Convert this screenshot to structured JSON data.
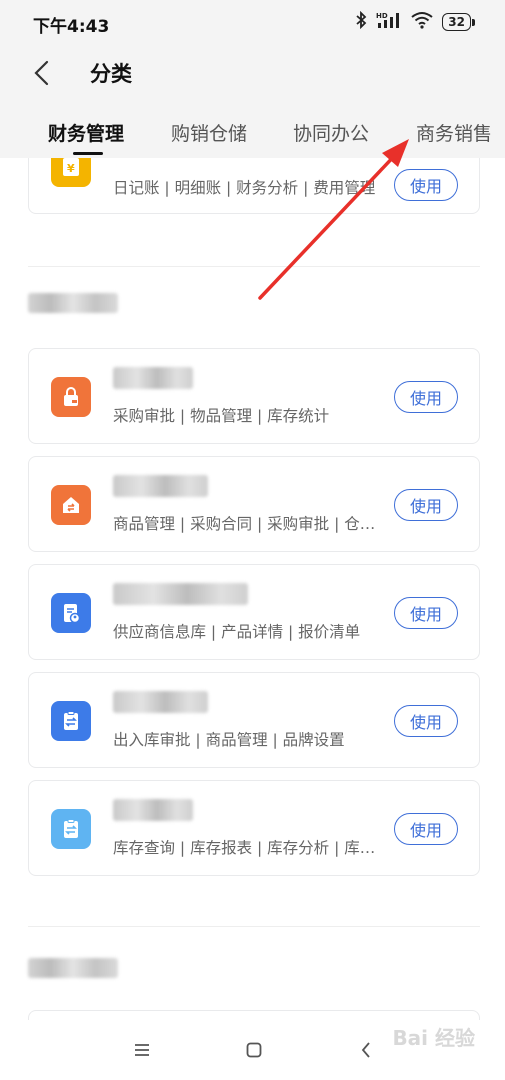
{
  "status_bar": {
    "time": "下午4:43",
    "battery": "32"
  },
  "header": {
    "title": "分类"
  },
  "tabs": [
    "财务管理",
    "购销仓储",
    "协同办公",
    "商务销售"
  ],
  "cards": [
    {
      "desc": "日记账 | 明细账 | 财务分析 | 费用管理",
      "button": "使用",
      "icon": "finance-icon",
      "color": "#f4b400"
    },
    {
      "desc": "采购审批 | 物品管理 | 库存统计",
      "button": "使用",
      "icon": "purchase-icon",
      "color": "#f0743a"
    },
    {
      "desc": "商品管理 | 采购合同 | 采购审批 | 仓库管理",
      "button": "使用",
      "icon": "warehouse-icon",
      "color": "#f0743a"
    },
    {
      "desc": "供应商信息库 | 产品详情 | 报价清单",
      "button": "使用",
      "icon": "supplier-icon",
      "color": "#3d7be8"
    },
    {
      "desc": "出入库审批 | 商品管理 | 品牌设置",
      "button": "使用",
      "icon": "inout-icon",
      "color": "#3d7be8"
    },
    {
      "desc": "库存查询 | 库存报表 | 库存分析 | 库存预警",
      "button": "使用",
      "icon": "inventory-icon",
      "color": "#5fb4f2"
    }
  ],
  "watermark": "Bai 经验"
}
